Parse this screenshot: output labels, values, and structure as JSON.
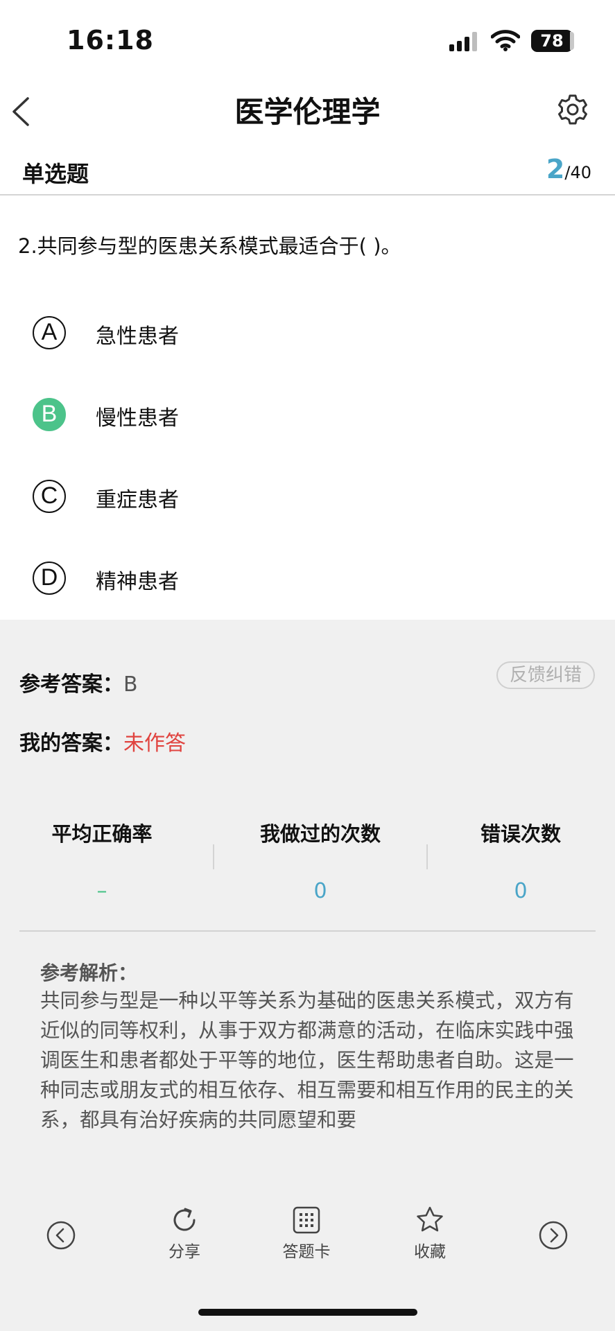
{
  "status_bar": {
    "time": "16:18",
    "battery": "78"
  },
  "nav": {
    "title": "医学伦理学"
  },
  "section": {
    "title": "单选题",
    "current": "2",
    "total": "/40"
  },
  "question": {
    "text": "2.共同参与型的医患关系模式最适合于( )。"
  },
  "options": [
    {
      "letter": "A",
      "text": "急性患者",
      "selected": false
    },
    {
      "letter": "B",
      "text": "慢性患者",
      "selected": true
    },
    {
      "letter": "C",
      "text": "重症患者",
      "selected": false
    },
    {
      "letter": "D",
      "text": "精神患者",
      "selected": false
    }
  ],
  "answers": {
    "ref_label": "参考答案：",
    "ref_value": "B",
    "mine_label": "我的答案：",
    "mine_value": "未作答",
    "feedback": "反馈纠错"
  },
  "stats": [
    {
      "label": "平均正确率",
      "value": "–"
    },
    {
      "label": "我做过的次数",
      "value": "0"
    },
    {
      "label": "错误次数",
      "value": "0"
    }
  ],
  "analysis": {
    "title": "参考解析：",
    "text": "共同参与型是一种以平等关系为基础的医患关系模式，双方有近似的同等权利，从事于双方都满意的活动，在临床实践中强调医生和患者都处于平等的地位，医生帮助患者自助。这是一种同志或朋友式的相互依存、相互需要和相互作用的民主的关系，都具有治好疾病的共同愿望和要"
  },
  "toolbar": {
    "share": "分享",
    "answer_card": "答题卡",
    "favorite": "收藏"
  },
  "colors": {
    "accent_blue": "#4aa5c8",
    "selected_green": "#4cc38a",
    "unanswered_red": "#e0433f"
  }
}
